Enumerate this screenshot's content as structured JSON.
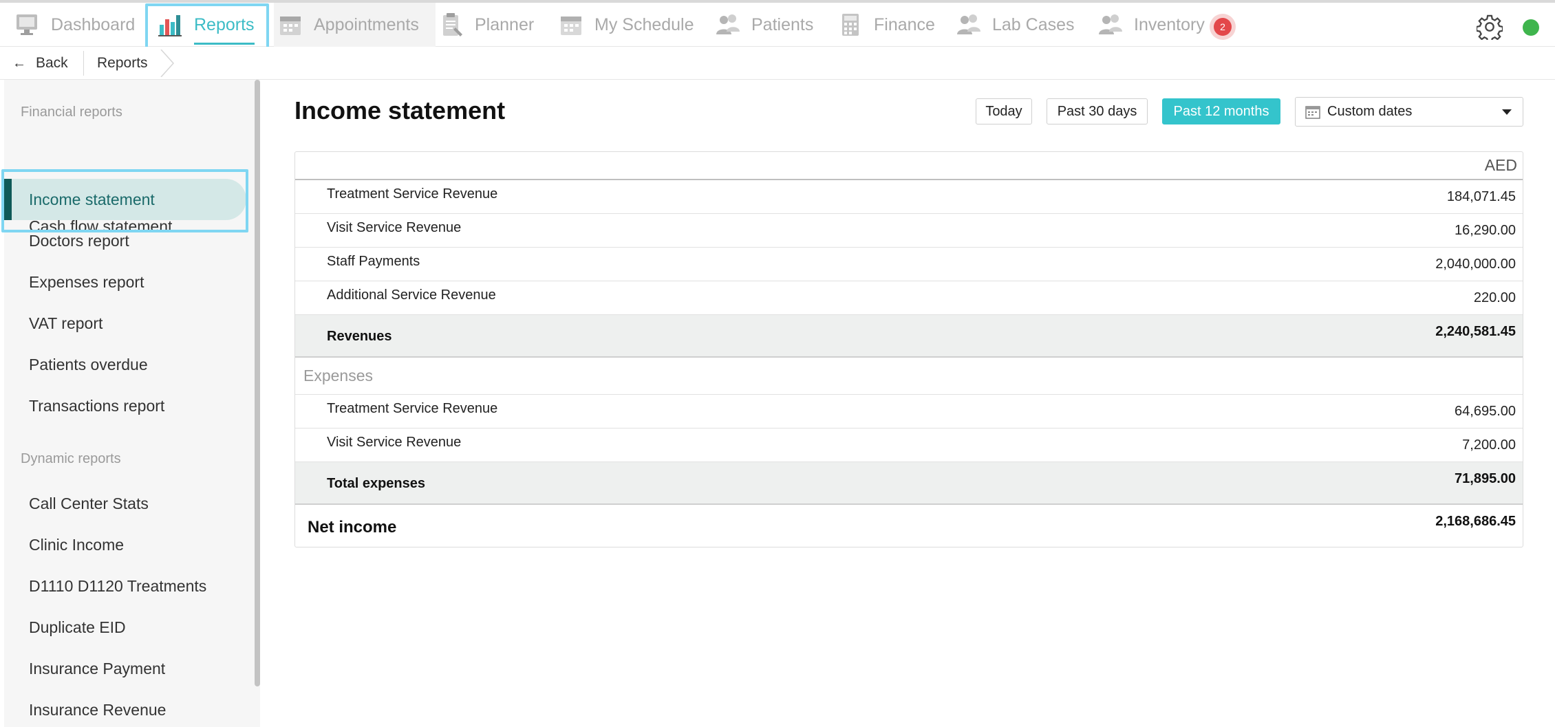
{
  "nav": {
    "items": [
      {
        "label": "Dashboard",
        "icon": "monitor-icon"
      },
      {
        "label": "Reports",
        "icon": "bar-chart-icon"
      },
      {
        "label": "Appointments",
        "icon": "calendar-icon"
      },
      {
        "label": "Planner",
        "icon": "clipboard-icon"
      },
      {
        "label": "My Schedule",
        "icon": "calendar-icon"
      },
      {
        "label": "Patients",
        "icon": "users-icon"
      },
      {
        "label": "Finance",
        "icon": "calculator-icon"
      },
      {
        "label": "Lab Cases",
        "icon": "users-icon"
      },
      {
        "label": "Inventory",
        "icon": "users-icon"
      }
    ],
    "active": "Reports",
    "inventory_badge": "2",
    "accent_color": "#3cbcc6",
    "status_color": "#3fb54d"
  },
  "breadcrumb": {
    "back_label": "Back",
    "current": "Reports"
  },
  "sidebar": {
    "financial_heading": "Financial reports",
    "financial_items": [
      "Cash flow statement",
      "Income statement",
      "Doctors report",
      "Expenses report",
      "VAT report",
      "Patients overdue",
      "Transactions report"
    ],
    "dynamic_heading": "Dynamic reports",
    "dynamic_items": [
      "Call Center Stats",
      "Clinic Income",
      "D1110 D1120 Treatments",
      "Duplicate EID",
      "Insurance Payment",
      "Insurance Revenue"
    ],
    "active_item": "Income statement"
  },
  "main": {
    "title": "Income statement",
    "filters": {
      "today": "Today",
      "past_30": "Past 30 days",
      "past_12": "Past 12 months",
      "custom": "Custom dates",
      "active": "Past 12 months"
    },
    "currency": "AED",
    "revenue_rows": [
      {
        "name": "Treatment Service Revenue",
        "amount": "184,071.45"
      },
      {
        "name": "Visit Service Revenue",
        "amount": "16,290.00"
      },
      {
        "name": "Staff Payments",
        "amount": "2,040,000.00"
      },
      {
        "name": "Additional Service Revenue",
        "amount": "220.00"
      }
    ],
    "revenues_total": {
      "name": "Revenues",
      "amount": "2,240,581.45"
    },
    "expenses_heading": "Expenses",
    "expense_rows": [
      {
        "name": "Treatment Service Revenue",
        "amount": "64,695.00"
      },
      {
        "name": "Visit Service Revenue",
        "amount": "7,200.00"
      }
    ],
    "expenses_total": {
      "name": "Total expenses",
      "amount": "71,895.00"
    },
    "net_income": {
      "name": "Net income",
      "amount": "2,168,686.45"
    }
  }
}
